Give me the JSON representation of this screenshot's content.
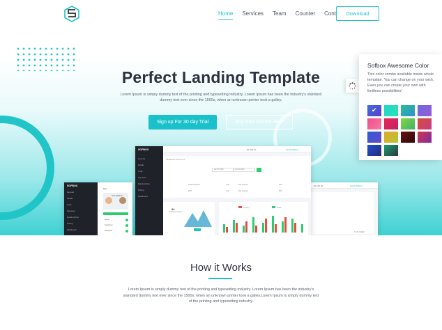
{
  "nav": {
    "items": [
      "Home",
      "Services",
      "Team",
      "Counter",
      "Contact"
    ],
    "download_label": "Download"
  },
  "hero": {
    "title": "Perfect Landing Template",
    "subtitle": "Lorem Ipsum is simply dummy text of the printing and typesetting industry. Lorem Ipsum has been the industry's standard dummy text ever since the 1500s, when an unknown printer took a galley.",
    "trial_label": "Sign up For 30 day Trial",
    "buy_label": "Buy Now license Here"
  },
  "mockup_main": {
    "brand": "SOFBOX",
    "sidebar": [
      "General",
      "Details",
      "Links",
      "Sponsors",
      "Relationships",
      "Pricing",
      "Dashboard"
    ],
    "balance": "$1,000.00",
    "user": "David Williams",
    "section_title": "GENERAL STATISTIC",
    "date_from": "Jul 07 2016",
    "date_to": "Jul 22 2016",
    "stats": [
      {
        "label": "Total Deposits",
        "value": "120"
      },
      {
        "label": "Net deposit",
        "value": "660"
      },
      {
        "label": "FTD",
        "value": "100"
      },
      {
        "label": "Net deposit",
        "value": "960"
      }
    ],
    "card_value": "84",
    "card_caption": "Marketing Report",
    "legend": [
      "Amount",
      "Traffic"
    ]
  },
  "mockup_left": {
    "brand": "SOFBOX",
    "sidebar": [
      "General",
      "Details",
      "Links",
      "Sponsors",
      "Relationships",
      "Pricing",
      "Dashboard"
    ],
    "label": "Skye",
    "name": "Jack Williams",
    "rows": [
      "Name",
      "Send item",
      "Deployed"
    ]
  },
  "mockup_right": {
    "balance": "$1,000.00",
    "user": "David Williams",
    "label": "THIS WEEK"
  },
  "color_panel": {
    "title": "Sofbox Awesome Color",
    "description": "This color combo available inside whole template. You can change on your wish, Even you can create your own with limitless possibilities!",
    "swatches": [
      [
        "#3d6de0",
        "#5a3cc8"
      ],
      [
        "#23d5c9",
        "#27e4b8"
      ],
      [
        "#27c08f",
        "#2d8fd6"
      ],
      [
        "#6b6cde",
        "#9a58d8"
      ],
      [
        "#f04d8d",
        "#f67aa0"
      ],
      [
        "#e8294f",
        "#c2206e"
      ],
      [
        "#8ad53a",
        "#3cb371"
      ],
      [
        "#d64c3a",
        "#c93b85"
      ],
      [
        "#2b5bd6",
        "#6b47c8"
      ],
      [
        "#e0a82a",
        "#b6c535"
      ],
      [
        "#6a1212",
        "#2e0a0a"
      ],
      [
        "#d23848",
        "#7e2aa8"
      ],
      [
        "#1f4fd0",
        "#2a2a7a"
      ],
      [
        "#1b9f6e",
        "#2c3a44"
      ]
    ]
  },
  "how": {
    "title": "How it Works",
    "text": "Lorem Ipsum is simply dummy text of the printing and typesetting industry. Lorem Ipsum has been the industry's standard dummy text ever since the 1500s, when an unknown printer took a galley.Lorem Ipsum is simply dummy text of the printing and typesetting industry."
  }
}
